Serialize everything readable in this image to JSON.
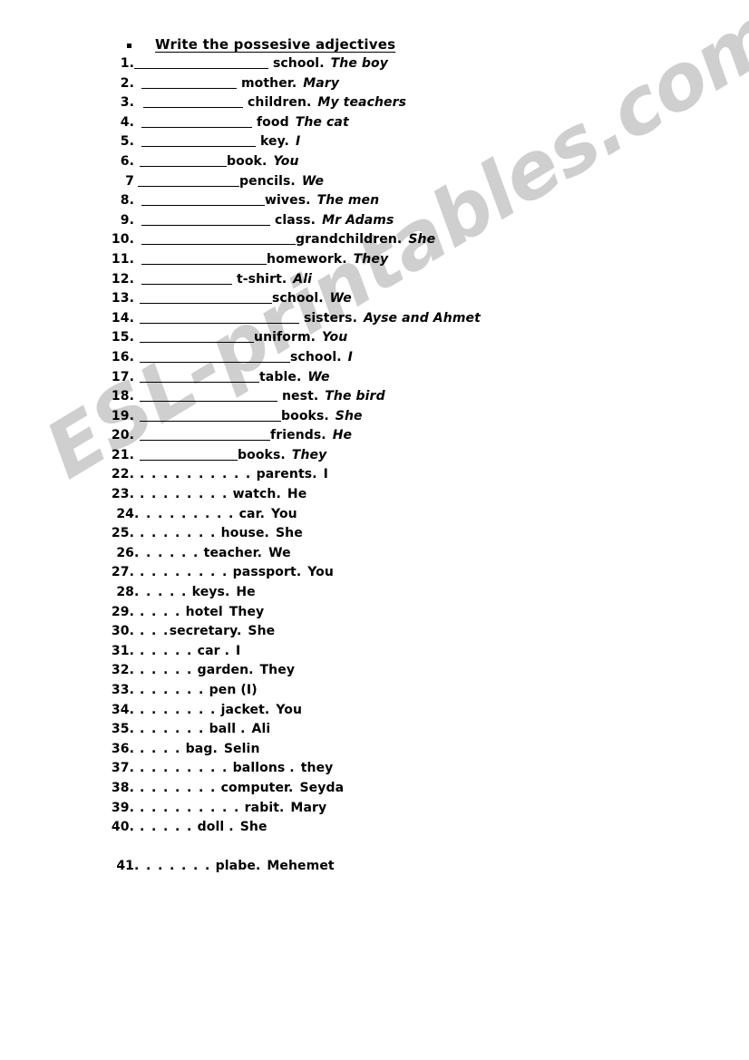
{
  "document": {
    "watermark": "ESL-printables.com",
    "watermark_color": "#cfcfcf",
    "page_background": "#ffffff",
    "text_color": "#000000"
  },
  "heading": {
    "bullet": "square-bullet",
    "text": "Write the possesive adjectives"
  },
  "sections": [
    {
      "id": "underline-section",
      "style": "blank-underline",
      "cue_style": "italic",
      "items": [
        {
          "num": "1.",
          "lead_space": 0,
          "blank": 148,
          "noun": " school.",
          "cue": "The boy"
        },
        {
          "num": "2.",
          "lead_space": 8,
          "blank": 105,
          "noun": " mother.",
          "cue": "Mary"
        },
        {
          "num": "3.",
          "lead_space": 10,
          "blank": 110,
          "noun": "  children.",
          "cue": "My teachers"
        },
        {
          "num": "4.",
          "lead_space": 8,
          "blank": 122,
          "noun": " food",
          "cue": "The cat"
        },
        {
          "num": "5.",
          "lead_space": 8,
          "blank": 126,
          "noun": " key.",
          "cue": "I"
        },
        {
          "num": "6.",
          "lead_space": 6,
          "blank": 96,
          "noun": "book.",
          "cue": "You"
        },
        {
          "num": "7",
          "lead_space": 4,
          "blank": 112,
          "noun": "pencils.",
          "cue": "We"
        },
        {
          "num": "8.",
          "lead_space": 8,
          "blank": 136,
          "noun": "wives.",
          "cue": "The men"
        },
        {
          "num": "9.",
          "lead_space": 8,
          "blank": 142,
          "noun": "  class.",
          "cue": "Mr Adams"
        },
        {
          "num": "10.",
          "lead_space": 8,
          "blank": 170,
          "noun": "grandchildren.",
          "cue": "She"
        },
        {
          "num": "11.",
          "lead_space": 8,
          "blank": 138,
          "noun": "homework.",
          "cue": "They"
        },
        {
          "num": "12.",
          "lead_space": 8,
          "blank": 100,
          "noun": "  t-shirt.",
          "cue": "Ali"
        },
        {
          "num": "13.",
          "lead_space": 6,
          "blank": 146,
          "noun": "school.",
          "cue": "We"
        },
        {
          "num": "14.",
          "lead_space": 6,
          "blank": 176,
          "noun": " sisters.",
          "cue": "Ayse and Ahmet"
        },
        {
          "num": "15.",
          "lead_space": 6,
          "blank": 126,
          "noun": "uniform.",
          "cue": "You"
        },
        {
          "num": "16.",
          "lead_space": 6,
          "blank": 166,
          "noun": "school.",
          "cue": "I"
        },
        {
          "num": "17.",
          "lead_space": 6,
          "blank": 132,
          "noun": "table.",
          "cue": "We"
        },
        {
          "num": "18.",
          "lead_space": 6,
          "blank": 152,
          "noun": " nest.",
          "cue": "The bird"
        },
        {
          "num": "19.",
          "lead_space": 6,
          "blank": 156,
          "noun": "books.",
          "cue": "She"
        },
        {
          "num": "20.",
          "lead_space": 6,
          "blank": 144,
          "noun": "friends.",
          "cue": "He"
        },
        {
          "num": "21.",
          "lead_space": 6,
          "blank": 108,
          "noun": "books.",
          "cue": "They"
        }
      ]
    },
    {
      "id": "dotted-section",
      "style": "blank-dots",
      "cue_style": "plain",
      "items": [
        {
          "num": "22.",
          "dots": ". . . . . . . . . .",
          "noun": " parents.",
          "cue": "I"
        },
        {
          "num": "23.",
          "dots": ". . . . . . . .",
          "noun": " watch.",
          "cue": "He",
          "tight": true
        },
        {
          "num": "24",
          "dots": ". . . . . . . . .",
          "noun": " car.",
          "cue": "You",
          "no_space": true
        },
        {
          "num": "25.",
          "dots": ". . . . . . .",
          "noun": " house.",
          "cue": "She"
        },
        {
          "num": "26",
          "dots": ". . . . . .",
          "noun": " teacher.",
          "cue": "We",
          "no_space": true
        },
        {
          "num": "27.",
          "dots": ". . . . . . . .",
          "noun": " passport.",
          "cue": "You"
        },
        {
          "num": "28",
          "dots": ". . . . .",
          "noun": " keys.",
          "cue": "He",
          "no_space": true
        },
        {
          "num": "29.",
          "dots": ". . . .",
          "noun": " hotel",
          "cue": "They"
        },
        {
          "num": "30.",
          "dots": ". . .",
          "noun": "secretary.",
          "cue": "She"
        },
        {
          "num": "31.",
          "dots": ". . . . .",
          "noun": " car .",
          "cue": "I"
        },
        {
          "num": "32.",
          "dots": ". . . . .",
          "noun": " garden.",
          "cue": "They"
        },
        {
          "num": "33.",
          "dots": ". . . . . .",
          "noun": " pen (I)",
          "cue": ""
        },
        {
          "num": "34.",
          "dots": ". . . . . . .",
          "noun": " jacket.",
          "cue": "You"
        },
        {
          "num": "35.",
          "dots": ". . . . . .",
          "noun": " ball .",
          "cue": "Ali"
        },
        {
          "num": "36.",
          "dots": ". . . .",
          "noun": " bag.",
          "cue": "Selin"
        },
        {
          "num": "37.",
          "dots": ". . . . . . . .",
          "noun": " ballons .",
          "cue": "they"
        },
        {
          "num": "38.",
          "dots": ". . . . . . .",
          "noun": " computer.",
          "cue": "Seyda"
        },
        {
          "num": "39.",
          "dots": ". . . . . . . . .",
          "noun": " rabit.",
          "cue": "Mary"
        },
        {
          "num": "40.",
          "dots": ". . . . .",
          "noun": " doll .",
          "cue": "She"
        }
      ]
    },
    {
      "id": "trailing-section",
      "style": "blank-dots",
      "cue_style": "plain",
      "spacer_before": true,
      "items": [
        {
          "num": "41",
          "dots": ". . . . . . .",
          "noun": " plabe.",
          "cue": "Mehemet",
          "no_space": true
        }
      ]
    }
  ]
}
